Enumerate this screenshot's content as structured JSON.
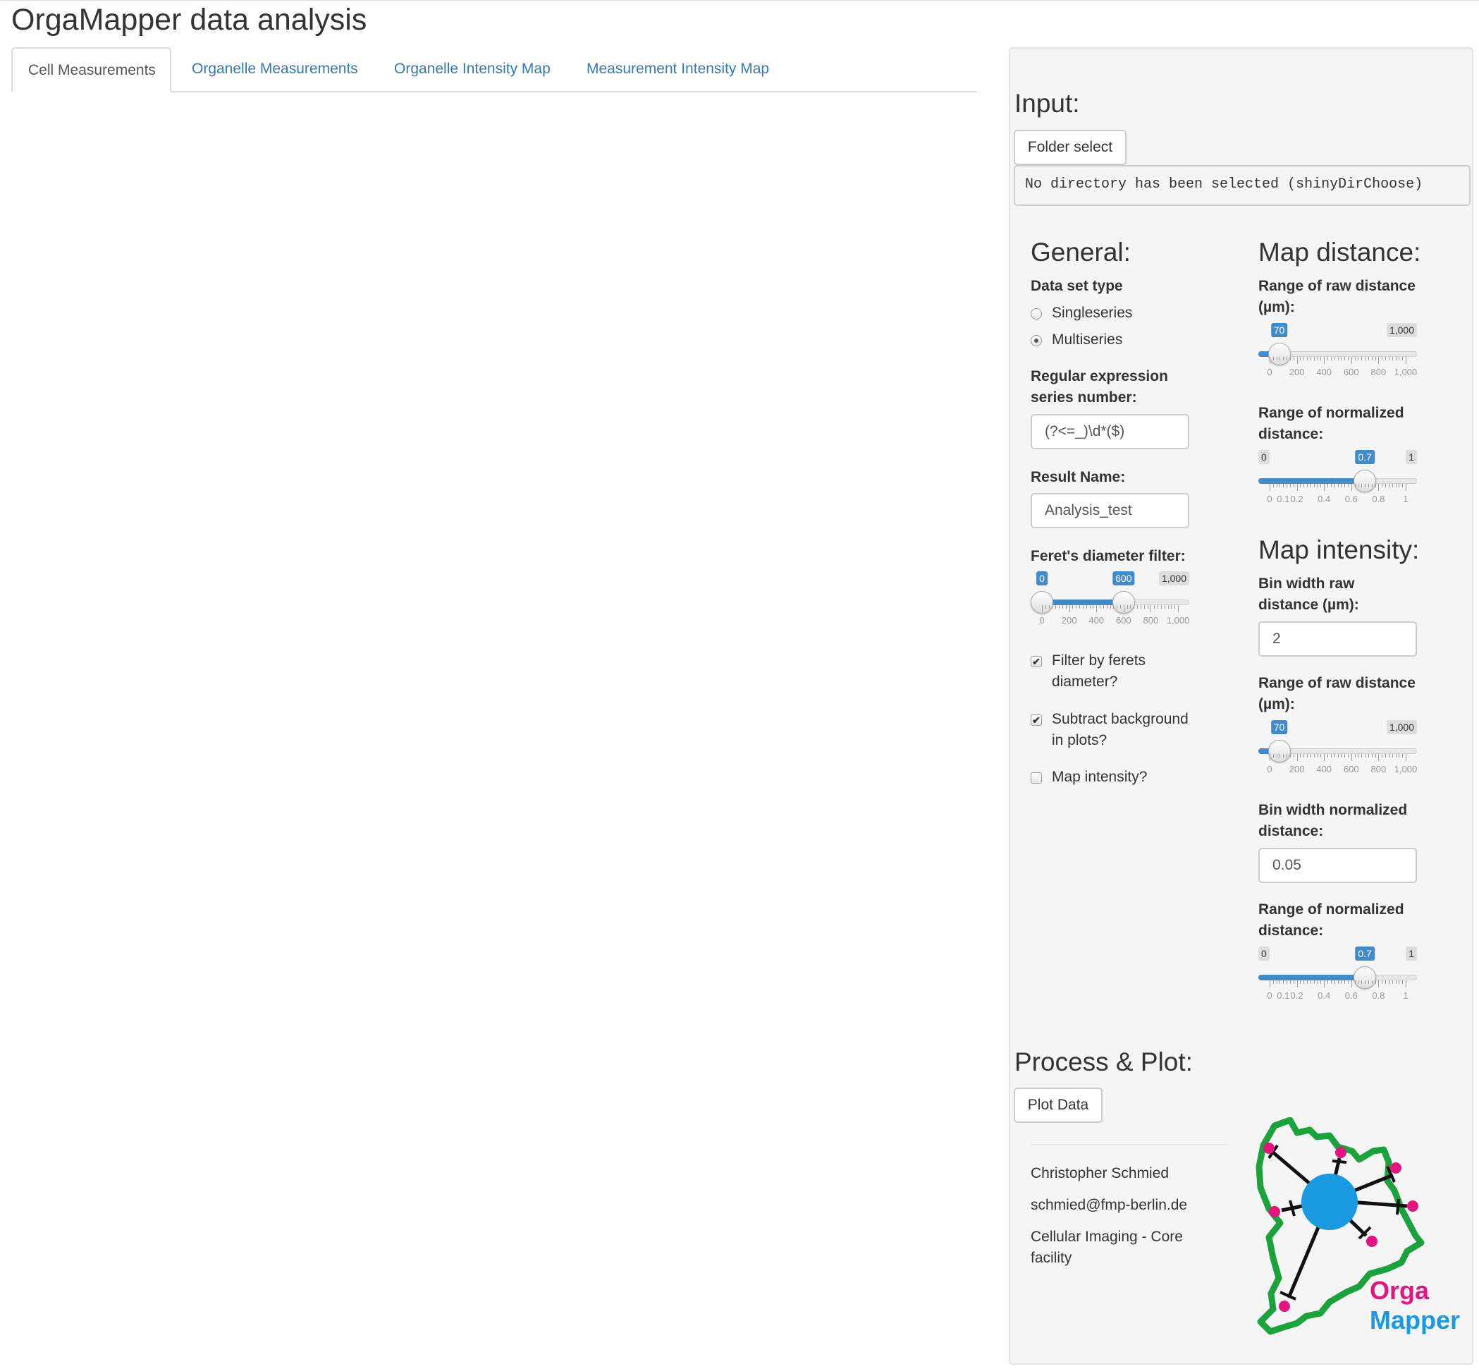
{
  "app": {
    "title": "OrgaMapper data analysis"
  },
  "tabs": [
    {
      "label": "Cell Measurements",
      "active": true
    },
    {
      "label": "Organelle Measurements",
      "active": false
    },
    {
      "label": "Organelle Intensity Map",
      "active": false
    },
    {
      "label": "Measurement Intensity Map",
      "active": false
    }
  ],
  "input": {
    "heading": "Input:",
    "folder_button": "Folder select",
    "directory_text": "No directory has been selected (shinyDirChoose)"
  },
  "general": {
    "heading": "General:",
    "dataset_label": "Data set type",
    "options": [
      "Singleseries",
      "Multiseries"
    ],
    "selected_option": "Multiseries",
    "regex_label": "Regular expression series number:",
    "regex_value": "(?<=_)\\d*($)",
    "result_label": "Result Name:",
    "result_value": "Analysis_test",
    "feret_label": "Feret's diameter filter:",
    "feret_slider": {
      "min": 0,
      "max": 1000,
      "from": 0,
      "to": 600,
      "min_label": "0",
      "max_label": "1,000",
      "from_label": "0",
      "to_label": "600",
      "ticks": [
        "0",
        "200",
        "400",
        "600",
        "800",
        "1,000"
      ]
    },
    "filter_feret_label": "Filter by ferets diameter?",
    "filter_feret_checked": true,
    "subtract_bg_label": "Subtract background in plots?",
    "subtract_bg_checked": true,
    "map_intensity_label": "Map intensity?",
    "map_intensity_checked": false
  },
  "map_distance": {
    "heading": "Map distance:",
    "raw_label": "Range of raw distance (µm):",
    "raw_slider": {
      "min": 0,
      "max": 1000,
      "value": 70,
      "value_label": "70",
      "max_label": "1,000",
      "ticks": [
        "0",
        "200",
        "400",
        "600",
        "800",
        "1,000"
      ]
    },
    "norm_label": "Range of normalized distance:",
    "norm_slider": {
      "min": 0,
      "max": 1,
      "value": 0.7,
      "value_label": "0.7",
      "min_label": "0",
      "max_label": "1",
      "ticks": [
        "0",
        "0.1",
        "0.2",
        "0.4",
        "0.6",
        "0.8",
        "1"
      ]
    }
  },
  "map_intensity": {
    "heading": "Map intensity:",
    "bin_raw_label": "Bin width raw distance (µm):",
    "bin_raw_value": "2",
    "raw_label": "Range of raw distance (µm):",
    "raw_slider": {
      "min": 0,
      "max": 1000,
      "value": 70,
      "value_label": "70",
      "max_label": "1,000",
      "ticks": [
        "0",
        "200",
        "400",
        "600",
        "800",
        "1,000"
      ]
    },
    "bin_norm_label": "Bin width normalized distance:",
    "bin_norm_value": "0.05",
    "norm_label": "Range of normalized distance:",
    "norm_slider": {
      "min": 0,
      "max": 1,
      "value": 0.7,
      "value_label": "0.7",
      "min_label": "0",
      "max_label": "1",
      "ticks": [
        "0",
        "0.1",
        "0.2",
        "0.4",
        "0.6",
        "0.8",
        "1"
      ]
    }
  },
  "process": {
    "heading": "Process & Plot:",
    "plot_button": "Plot Data"
  },
  "footer": {
    "author": "Christopher Schmied",
    "email": "schmied@fmp-berlin.de",
    "facility": "Cellular Imaging - Core facility"
  },
  "logo": {
    "word1": "Orga",
    "word2": "Mapper",
    "outline_color": "#1aa33a",
    "center_color": "#1899e0",
    "dot_color": "#e5157f",
    "word1_color": "#e5157f",
    "word2_color": "#1899e0"
  },
  "colors": {
    "accent": "#428bca",
    "link": "#337ab7",
    "panel": "#f5f5f5"
  }
}
